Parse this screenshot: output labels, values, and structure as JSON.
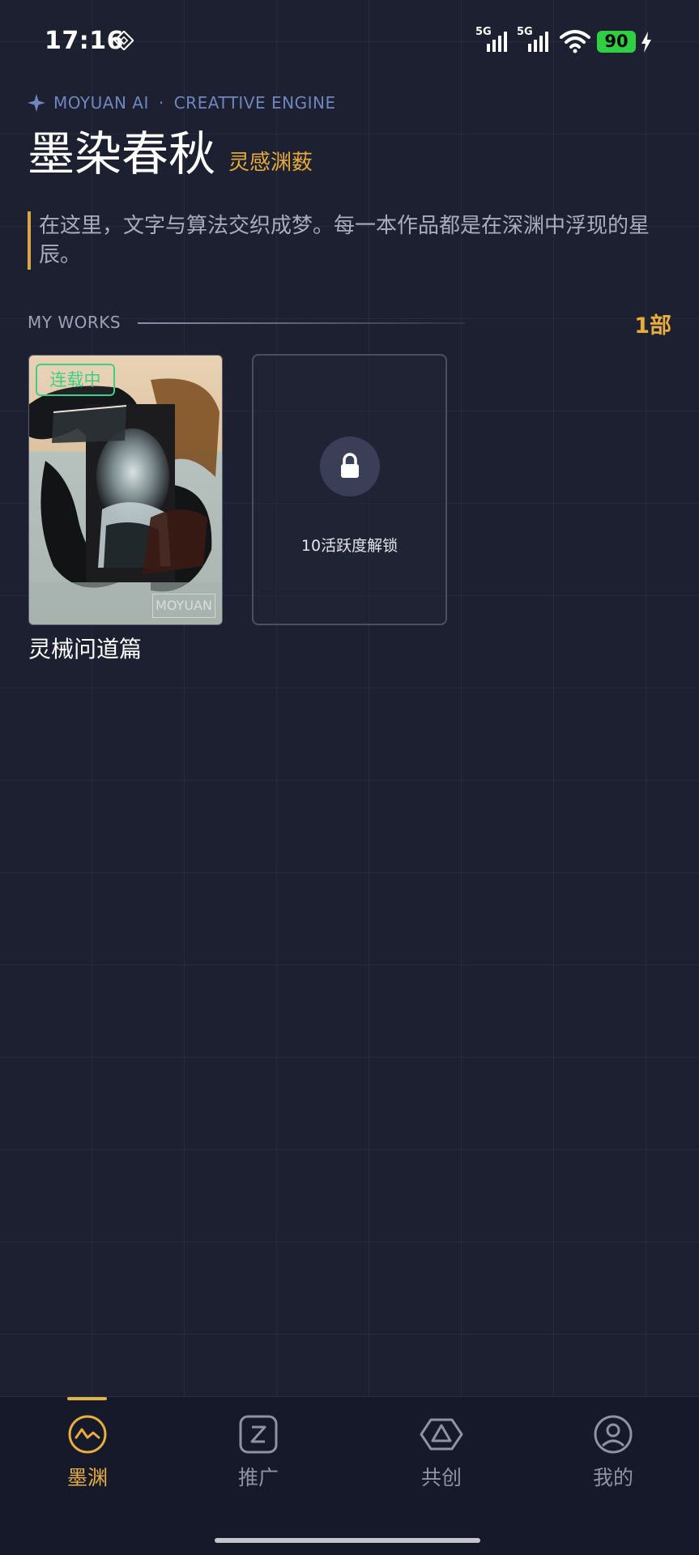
{
  "status_bar": {
    "time": "17:16",
    "network_1": "5G",
    "network_2": "5G",
    "battery": "90"
  },
  "header": {
    "brand": "MOYUAN AI",
    "separator": "·",
    "engine": "CREATTIVE ENGINE",
    "title": "墨染春秋",
    "subtitle": "灵感渊薮",
    "quote": "在这里，文字与算法交织成梦。每一本作品都是在深渊中浮现的星辰。"
  },
  "works": {
    "section_label": "MY WORKS",
    "count": "1部",
    "books": [
      {
        "status": "连载中",
        "title": "灵械问道篇",
        "stamp": "MOYUAN"
      }
    ],
    "locked": {
      "text": "10活跃度解锁"
    }
  },
  "tab_bar": {
    "active_index": 0,
    "tabs": [
      {
        "label": "墨渊",
        "icon": "pulse-circle-icon"
      },
      {
        "label": "推广",
        "icon": "z-square-icon"
      },
      {
        "label": "共创",
        "icon": "triangle-hexagon-icon"
      },
      {
        "label": "我的",
        "icon": "user-circle-icon"
      }
    ]
  },
  "colors": {
    "background": "#1d2030",
    "accent": "#e7ad3e",
    "brand_blue": "#6f86bf",
    "status_green": "#3ecf86",
    "battery_green": "#2fcf43"
  }
}
